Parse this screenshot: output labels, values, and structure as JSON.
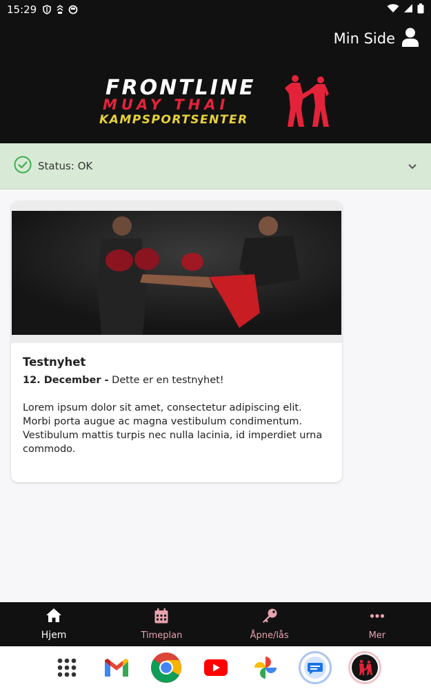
{
  "status_bar": {
    "time": "15:29"
  },
  "header": {
    "min_side_label": "Min Side"
  },
  "logo": {
    "line1": "FRONTLINE",
    "line2": "MUAY THAI",
    "line3": "KAMPSPORTSENTER"
  },
  "status": {
    "text": "Status: OK"
  },
  "news": {
    "title": "Testnyhet",
    "date": "12. December -",
    "summary": " Dette er en testnyhet!",
    "body": "Lorem ipsum dolor sit amet, consectetur adipiscing elit. Morbi porta augue ac magna vestibulum condimentum. Vestibulum mattis turpis nec nulla lacinia, id imperdiet urna commodo."
  },
  "bottom_nav": {
    "items": [
      {
        "label": "Hjem",
        "icon": "home-icon",
        "active": true
      },
      {
        "label": "Timeplan",
        "icon": "calendar-icon",
        "active": false
      },
      {
        "label": "Åpne/lås",
        "icon": "key-icon",
        "active": false
      },
      {
        "label": "Mer",
        "icon": "more-icon",
        "active": false
      }
    ]
  },
  "dock": {
    "apps": [
      "app-drawer-icon",
      "gmail-icon",
      "chrome-icon",
      "youtube-icon",
      "photos-icon",
      "messages-icon",
      "frontline-app-icon"
    ]
  },
  "colors": {
    "header_bg": "#111111",
    "status_bg": "#d8ead6",
    "status_ok": "#3fae4f",
    "accent_red": "#e4233a",
    "accent_yellow": "#e8d13a",
    "nav_inactive": "#e8a3ae"
  }
}
